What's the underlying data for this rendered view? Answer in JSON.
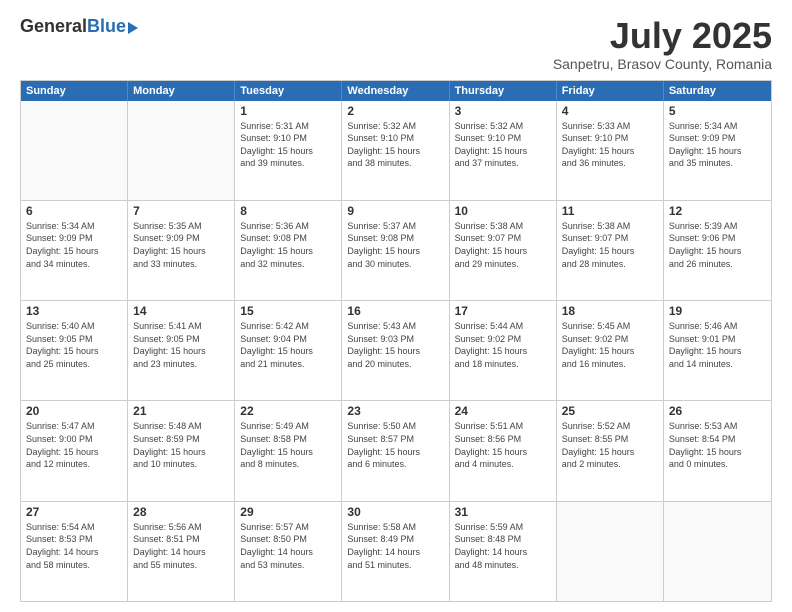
{
  "logo": {
    "general": "General",
    "blue": "Blue"
  },
  "title": {
    "month": "July 2025",
    "location": "Sanpetru, Brasov County, Romania"
  },
  "weekdays": [
    "Sunday",
    "Monday",
    "Tuesday",
    "Wednesday",
    "Thursday",
    "Friday",
    "Saturday"
  ],
  "rows": [
    [
      {
        "day": "",
        "text": ""
      },
      {
        "day": "",
        "text": ""
      },
      {
        "day": "1",
        "text": "Sunrise: 5:31 AM\nSunset: 9:10 PM\nDaylight: 15 hours\nand 39 minutes."
      },
      {
        "day": "2",
        "text": "Sunrise: 5:32 AM\nSunset: 9:10 PM\nDaylight: 15 hours\nand 38 minutes."
      },
      {
        "day": "3",
        "text": "Sunrise: 5:32 AM\nSunset: 9:10 PM\nDaylight: 15 hours\nand 37 minutes."
      },
      {
        "day": "4",
        "text": "Sunrise: 5:33 AM\nSunset: 9:10 PM\nDaylight: 15 hours\nand 36 minutes."
      },
      {
        "day": "5",
        "text": "Sunrise: 5:34 AM\nSunset: 9:09 PM\nDaylight: 15 hours\nand 35 minutes."
      }
    ],
    [
      {
        "day": "6",
        "text": "Sunrise: 5:34 AM\nSunset: 9:09 PM\nDaylight: 15 hours\nand 34 minutes."
      },
      {
        "day": "7",
        "text": "Sunrise: 5:35 AM\nSunset: 9:09 PM\nDaylight: 15 hours\nand 33 minutes."
      },
      {
        "day": "8",
        "text": "Sunrise: 5:36 AM\nSunset: 9:08 PM\nDaylight: 15 hours\nand 32 minutes."
      },
      {
        "day": "9",
        "text": "Sunrise: 5:37 AM\nSunset: 9:08 PM\nDaylight: 15 hours\nand 30 minutes."
      },
      {
        "day": "10",
        "text": "Sunrise: 5:38 AM\nSunset: 9:07 PM\nDaylight: 15 hours\nand 29 minutes."
      },
      {
        "day": "11",
        "text": "Sunrise: 5:38 AM\nSunset: 9:07 PM\nDaylight: 15 hours\nand 28 minutes."
      },
      {
        "day": "12",
        "text": "Sunrise: 5:39 AM\nSunset: 9:06 PM\nDaylight: 15 hours\nand 26 minutes."
      }
    ],
    [
      {
        "day": "13",
        "text": "Sunrise: 5:40 AM\nSunset: 9:05 PM\nDaylight: 15 hours\nand 25 minutes."
      },
      {
        "day": "14",
        "text": "Sunrise: 5:41 AM\nSunset: 9:05 PM\nDaylight: 15 hours\nand 23 minutes."
      },
      {
        "day": "15",
        "text": "Sunrise: 5:42 AM\nSunset: 9:04 PM\nDaylight: 15 hours\nand 21 minutes."
      },
      {
        "day": "16",
        "text": "Sunrise: 5:43 AM\nSunset: 9:03 PM\nDaylight: 15 hours\nand 20 minutes."
      },
      {
        "day": "17",
        "text": "Sunrise: 5:44 AM\nSunset: 9:02 PM\nDaylight: 15 hours\nand 18 minutes."
      },
      {
        "day": "18",
        "text": "Sunrise: 5:45 AM\nSunset: 9:02 PM\nDaylight: 15 hours\nand 16 minutes."
      },
      {
        "day": "19",
        "text": "Sunrise: 5:46 AM\nSunset: 9:01 PM\nDaylight: 15 hours\nand 14 minutes."
      }
    ],
    [
      {
        "day": "20",
        "text": "Sunrise: 5:47 AM\nSunset: 9:00 PM\nDaylight: 15 hours\nand 12 minutes."
      },
      {
        "day": "21",
        "text": "Sunrise: 5:48 AM\nSunset: 8:59 PM\nDaylight: 15 hours\nand 10 minutes."
      },
      {
        "day": "22",
        "text": "Sunrise: 5:49 AM\nSunset: 8:58 PM\nDaylight: 15 hours\nand 8 minutes."
      },
      {
        "day": "23",
        "text": "Sunrise: 5:50 AM\nSunset: 8:57 PM\nDaylight: 15 hours\nand 6 minutes."
      },
      {
        "day": "24",
        "text": "Sunrise: 5:51 AM\nSunset: 8:56 PM\nDaylight: 15 hours\nand 4 minutes."
      },
      {
        "day": "25",
        "text": "Sunrise: 5:52 AM\nSunset: 8:55 PM\nDaylight: 15 hours\nand 2 minutes."
      },
      {
        "day": "26",
        "text": "Sunrise: 5:53 AM\nSunset: 8:54 PM\nDaylight: 15 hours\nand 0 minutes."
      }
    ],
    [
      {
        "day": "27",
        "text": "Sunrise: 5:54 AM\nSunset: 8:53 PM\nDaylight: 14 hours\nand 58 minutes."
      },
      {
        "day": "28",
        "text": "Sunrise: 5:56 AM\nSunset: 8:51 PM\nDaylight: 14 hours\nand 55 minutes."
      },
      {
        "day": "29",
        "text": "Sunrise: 5:57 AM\nSunset: 8:50 PM\nDaylight: 14 hours\nand 53 minutes."
      },
      {
        "day": "30",
        "text": "Sunrise: 5:58 AM\nSunset: 8:49 PM\nDaylight: 14 hours\nand 51 minutes."
      },
      {
        "day": "31",
        "text": "Sunrise: 5:59 AM\nSunset: 8:48 PM\nDaylight: 14 hours\nand 48 minutes."
      },
      {
        "day": "",
        "text": ""
      },
      {
        "day": "",
        "text": ""
      }
    ]
  ]
}
